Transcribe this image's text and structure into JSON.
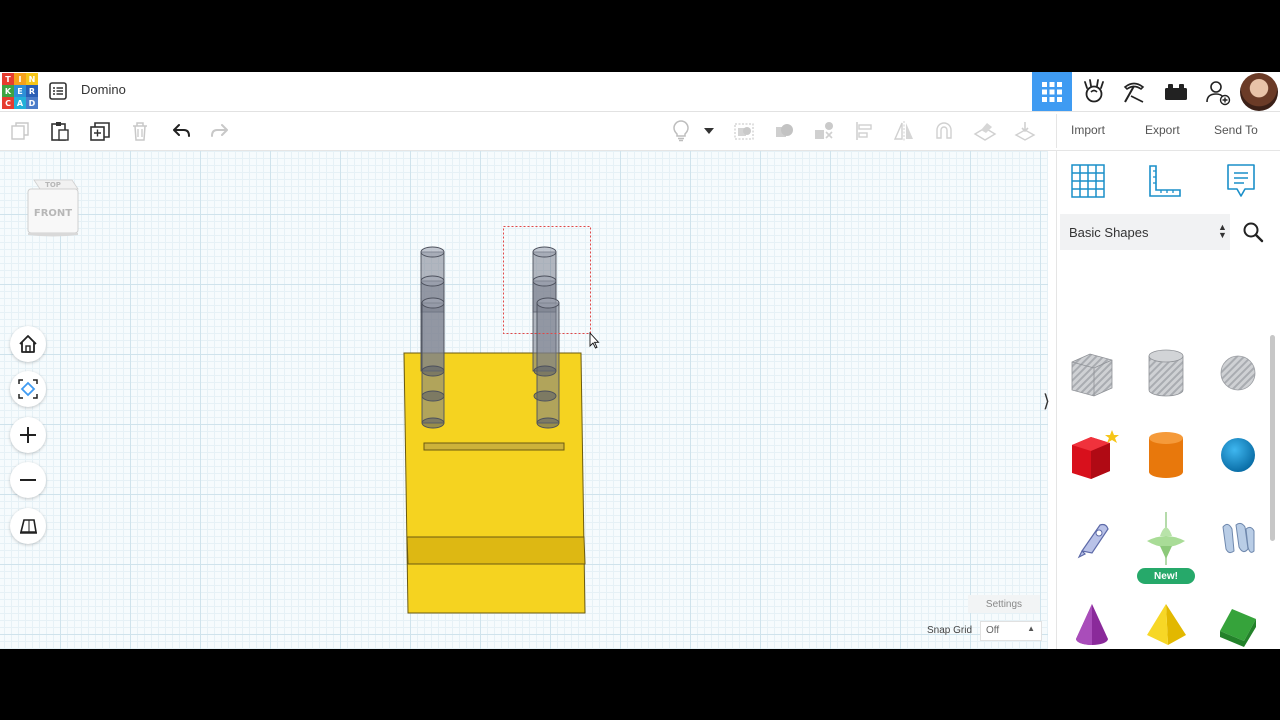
{
  "header": {
    "logo_letters": [
      "T",
      "I",
      "N",
      "K",
      "E",
      "R",
      "C",
      "A",
      "D"
    ],
    "logo_colors": [
      "#e63c2f",
      "#f6a01a",
      "#f6c618",
      "#3da443",
      "#2e8fd6",
      "#2a5fb5",
      "#e63c2f",
      "#23b0d8",
      "#4a7cc9"
    ],
    "design_title": "Domino",
    "icons": [
      "list-icon",
      "grid-3d-icon",
      "tinkerers-icon",
      "build-icon",
      "bricks-icon",
      "add-user-icon",
      "avatar"
    ],
    "accent": "#3f9bf2"
  },
  "toolbar": {
    "left_icons": [
      "copy-icon",
      "paste-icon",
      "duplicate-icon",
      "delete-icon",
      "undo-icon",
      "redo-icon"
    ],
    "tool_icons": [
      "lightbulb-icon",
      "dropdown-caret-icon",
      "group-icon",
      "solid-icon",
      "ungroup-icon",
      "align-icon",
      "mirror-icon",
      "cruise-icon",
      "workplane-icon",
      "drop-icon"
    ],
    "import_label": "Import",
    "export_label": "Export",
    "send_to_label": "Send To"
  },
  "workplane": {
    "viewcube": {
      "top_label": "TOP",
      "front_label": "FRONT"
    },
    "nav_icons": [
      "home-icon",
      "fit-view-icon",
      "zoom-in-icon",
      "zoom-out-icon",
      "perspective-icon"
    ],
    "settings_label": "Settings",
    "snap_grid_label": "Snap Grid",
    "snap_grid_value": "Off"
  },
  "panel": {
    "view_icons": [
      "workplane-grid-icon",
      "ruler-icon",
      "notes-icon"
    ],
    "library": "Basic Shapes",
    "new_badge": "New!",
    "shapes": [
      "box-hole-shape",
      "cylinder-hole-shape",
      "sphere-hole-shape",
      "box-shape",
      "cylinder-shape",
      "sphere-shape",
      "scribble-shape",
      "new-shape",
      "text-3d-shape",
      "cone-shape",
      "pyramid-shape",
      "roof-shape",
      "text-shape",
      "tube-shape",
      "torus-shape"
    ]
  }
}
